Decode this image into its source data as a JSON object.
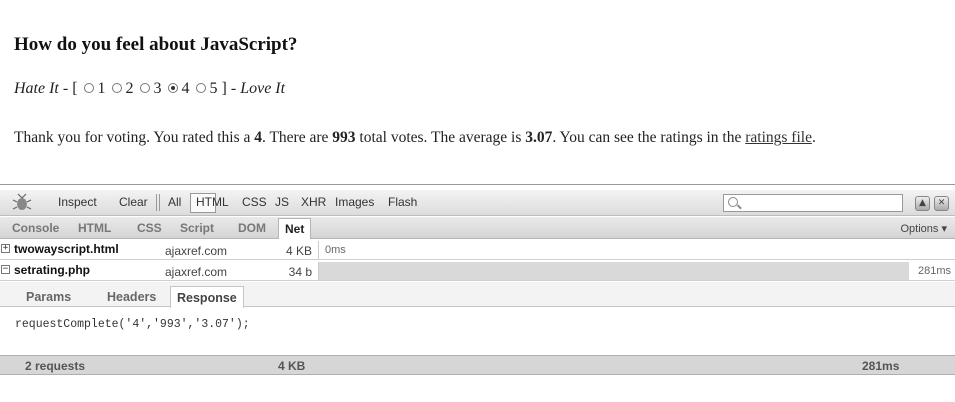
{
  "page": {
    "title": "How do you feel about JavaScript?",
    "rating": {
      "left_label": "Hate It",
      "dash_open": " - [",
      "options": [
        "1",
        "2",
        "3",
        "4",
        "5"
      ],
      "selected": "4",
      "close_dash": "] - ",
      "right_label": "Love It"
    },
    "result": {
      "t1": "Thank you for voting. You rated this a ",
      "rated": "4",
      "t2": ". There are ",
      "votes": "993",
      "t3": " total votes. The average is ",
      "average": "3.07",
      "t4": ". You can see the ratings in the ",
      "link": "ratings file",
      "t5": "."
    }
  },
  "firebug": {
    "toolbar": {
      "inspect": "Inspect",
      "clear": "Clear",
      "filters": [
        "All",
        "HTML",
        "CSS",
        "JS",
        "XHR",
        "Images",
        "Flash"
      ],
      "selected_filter": "All",
      "search_placeholder": ""
    },
    "tabs": [
      "Console",
      "HTML",
      "CSS",
      "Script",
      "DOM",
      "Net"
    ],
    "active_tab": "Net",
    "options_label": "Options ▾",
    "requests": [
      {
        "toggle": "+",
        "file": "twowayscript.html",
        "domain": "ajaxref.com",
        "size": "4 KB",
        "time": "0ms"
      },
      {
        "toggle": "−",
        "file": "setrating.php",
        "domain": "ajaxref.com",
        "size": "34 b",
        "time": "281ms"
      }
    ],
    "sub_tabs": [
      "Params",
      "Headers",
      "Response"
    ],
    "active_sub_tab": "Response",
    "response_text": "requestComplete('4','993','3.07');",
    "summary": {
      "requests": "2 requests",
      "size": "4 KB",
      "time": "281ms"
    }
  },
  "colors": {
    "toolbar_bg": "#dcdcdc",
    "timeline_bar": "#d9d9d9",
    "summary_bg": "#d6d6d6"
  }
}
